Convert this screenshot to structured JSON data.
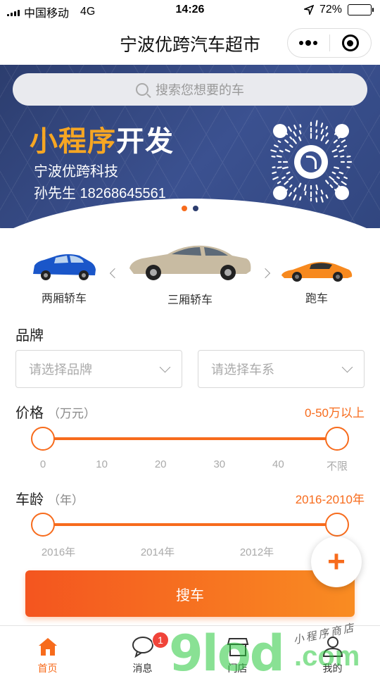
{
  "status_bar": {
    "carrier": "中国移动",
    "network": "4G",
    "time": "14:26",
    "battery": "72%",
    "battery_level": 0.72
  },
  "navbar": {
    "title": "宁波优跨汽车超市",
    "more_icon": "more-dots-icon",
    "close_icon": "target-circle-icon"
  },
  "banner": {
    "search_placeholder": "搜索您想要的车",
    "headline_highlight": "小程序",
    "headline_rest": "开发",
    "company": "宁波优跨科技",
    "contact": "孙先生 18268645561",
    "indicator_active_color": "#f76b1c",
    "indicator_inactive_color": "#2c3d6e",
    "slide_count": 2,
    "active_slide": 1
  },
  "categories": [
    {
      "label": "两厢轿车",
      "color": "#1a56c9"
    },
    {
      "label": "三厢轿车",
      "color": "#c8bba2"
    },
    {
      "label": "跑车",
      "color": "#f7891e"
    }
  ],
  "brand": {
    "title": "品牌",
    "brand_placeholder": "请选择品牌",
    "series_placeholder": "请选择车系"
  },
  "price": {
    "title": "价格",
    "unit": "（万元）",
    "range": "0-50万以上",
    "ticks": [
      "0",
      "10",
      "20",
      "30",
      "40",
      "不限"
    ],
    "min_value": 0,
    "max_value": "不限"
  },
  "age": {
    "title": "车龄",
    "unit": "（年）",
    "range": "2016-2010年",
    "ticks": [
      "2016年",
      "2014年",
      "2012年"
    ],
    "min_value": 2016,
    "max_value": 2010
  },
  "search_button": "搜车",
  "fab": "+",
  "tabs": [
    {
      "label": "首页",
      "icon": "home-icon",
      "active": true
    },
    {
      "label": "消息",
      "icon": "message-icon",
      "badge": "1"
    },
    {
      "label": "门店",
      "icon": "store-icon"
    },
    {
      "label": "我的",
      "icon": "profile-icon"
    }
  ],
  "watermark": {
    "text": "9lod",
    "domain": ".com",
    "caption": "小程序商店"
  },
  "accent_color": "#f76b1c"
}
